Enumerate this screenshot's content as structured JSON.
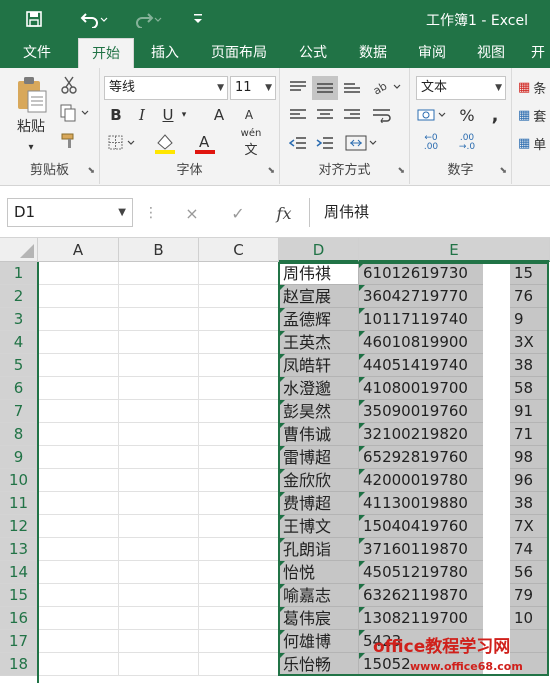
{
  "titlebar": {
    "title": "工作簿1 - Excel",
    "save_icon": "save-icon",
    "undo_icon": "undo-icon",
    "redo_icon": "redo-icon",
    "customize_icon": "customize-quick-access-icon"
  },
  "tabs": [
    {
      "label": "文件"
    },
    {
      "label": "开始"
    },
    {
      "label": "插入"
    },
    {
      "label": "页面布局"
    },
    {
      "label": "公式"
    },
    {
      "label": "数据"
    },
    {
      "label": "审阅"
    },
    {
      "label": "视图"
    },
    {
      "label": "开"
    }
  ],
  "ribbon": {
    "clipboard": {
      "label": "剪贴板",
      "paste_label": "粘贴"
    },
    "font": {
      "label": "字体",
      "font_name": "等线",
      "font_size": "11",
      "bold": "B",
      "italic": "I",
      "underline": "U",
      "grow": "A",
      "shrink": "A",
      "font_color": "A",
      "phonetic": "wén"
    },
    "alignment": {
      "label": "对齐方式"
    },
    "number": {
      "label": "数字",
      "format": "文本",
      "percent": "%",
      "comma": ","
    },
    "styles": {
      "label_fragments": [
        "条",
        "套",
        "单"
      ]
    }
  },
  "formula_bar": {
    "name_box": "D1",
    "cancel_icon": "×",
    "enter_icon": "✓",
    "fx_label": "fx",
    "value": "周伟祺"
  },
  "grid": {
    "columns": [
      "A",
      "B",
      "C",
      "D",
      "E"
    ],
    "rows": [
      {
        "n": "1",
        "d": "周伟祺",
        "e_left": "61012619730",
        "e_right": "15"
      },
      {
        "n": "2",
        "d": "赵宣展",
        "e_left": "36042719770",
        "e_right": "76"
      },
      {
        "n": "3",
        "d": "孟德辉",
        "e_left": "10117119740",
        "e_right": "9"
      },
      {
        "n": "4",
        "d": "王英杰",
        "e_left": "46010819900",
        "e_right": "3X"
      },
      {
        "n": "5",
        "d": "凤皓轩",
        "e_left": "44051419740",
        "e_right": "38"
      },
      {
        "n": "6",
        "d": "水澄邈",
        "e_left": "41080019700",
        "e_right": "58"
      },
      {
        "n": "7",
        "d": "彭昊然",
        "e_left": "35090019760",
        "e_right": "91"
      },
      {
        "n": "8",
        "d": "曹伟诚",
        "e_left": "32100219820",
        "e_right": "71"
      },
      {
        "n": "9",
        "d": "雷博超",
        "e_left": "65292819760",
        "e_right": "98"
      },
      {
        "n": "10",
        "d": "金欣欣",
        "e_left": "42000019780",
        "e_right": "96"
      },
      {
        "n": "11",
        "d": "费博超",
        "e_left": "41130019880",
        "e_right": "38"
      },
      {
        "n": "12",
        "d": "王博文",
        "e_left": "15040419760",
        "e_right": "7X"
      },
      {
        "n": "13",
        "d": "孔朗诣",
        "e_left": "37160119870",
        "e_right": "74"
      },
      {
        "n": "14",
        "d": "怡悦",
        "e_left": "45051219780",
        "e_right": "56"
      },
      {
        "n": "15",
        "d": "喻嘉志",
        "e_left": "63262119870",
        "e_right": "79"
      },
      {
        "n": "16",
        "d": "葛伟宸",
        "e_left": "13082119700",
        "e_right": "10"
      },
      {
        "n": "17",
        "d": "何雄博",
        "e_left": "5423",
        "e_right": ""
      },
      {
        "n": "18",
        "d": "乐怡畅",
        "e_left": "15052",
        "e_right": ""
      }
    ]
  },
  "watermark": {
    "text": "office教程学习网",
    "url": "www.office68.com"
  },
  "colors": {
    "accent": "#217346",
    "selection": "#c6c6c6",
    "watermark": "#d0201b"
  }
}
